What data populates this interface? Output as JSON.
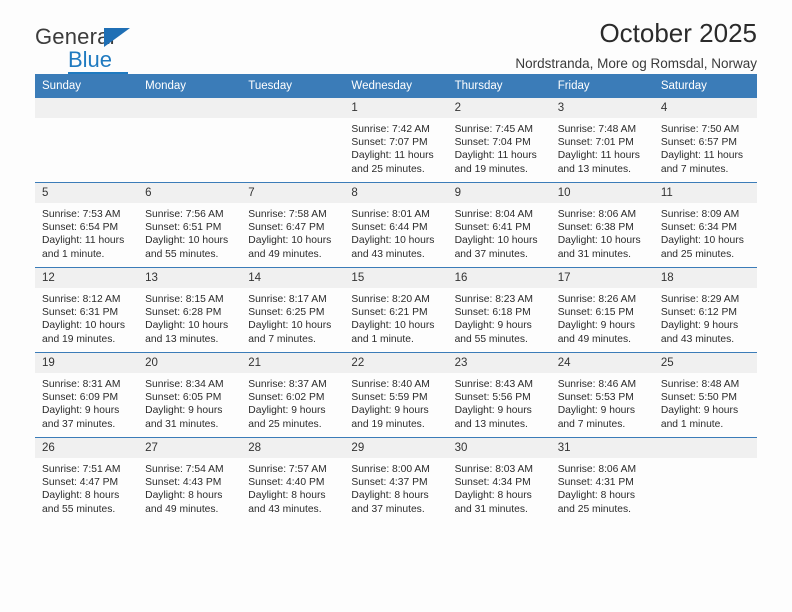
{
  "brand": {
    "name_part1": "General",
    "name_part2": "Blue",
    "triangle_icon": "triangle-icon",
    "accent_color": "#1f7ac0"
  },
  "header": {
    "title": "October 2025",
    "subtitle": "Nordstranda, More og Romsdal, Norway",
    "header_bg_color": "#3b7cb8",
    "daynum_bg_color": "#f0f0f0"
  },
  "weekday_headers": [
    "Sunday",
    "Monday",
    "Tuesday",
    "Wednesday",
    "Thursday",
    "Friday",
    "Saturday"
  ],
  "labels": {
    "sunrise": "Sunrise:",
    "sunset": "Sunset:",
    "daylight": "Daylight:"
  },
  "weeks": [
    [
      {
        "day": "",
        "empty": true
      },
      {
        "day": "",
        "empty": true
      },
      {
        "day": "",
        "empty": true
      },
      {
        "day": "1",
        "sunrise": "Sunrise: 7:42 AM",
        "sunset": "Sunset: 7:07 PM",
        "daylight_line1": "Daylight: 11 hours",
        "daylight_line2": "and 25 minutes."
      },
      {
        "day": "2",
        "sunrise": "Sunrise: 7:45 AM",
        "sunset": "Sunset: 7:04 PM",
        "daylight_line1": "Daylight: 11 hours",
        "daylight_line2": "and 19 minutes."
      },
      {
        "day": "3",
        "sunrise": "Sunrise: 7:48 AM",
        "sunset": "Sunset: 7:01 PM",
        "daylight_line1": "Daylight: 11 hours",
        "daylight_line2": "and 13 minutes."
      },
      {
        "day": "4",
        "sunrise": "Sunrise: 7:50 AM",
        "sunset": "Sunset: 6:57 PM",
        "daylight_line1": "Daylight: 11 hours",
        "daylight_line2": "and 7 minutes."
      }
    ],
    [
      {
        "day": "5",
        "sunrise": "Sunrise: 7:53 AM",
        "sunset": "Sunset: 6:54 PM",
        "daylight_line1": "Daylight: 11 hours",
        "daylight_line2": "and 1 minute."
      },
      {
        "day": "6",
        "sunrise": "Sunrise: 7:56 AM",
        "sunset": "Sunset: 6:51 PM",
        "daylight_line1": "Daylight: 10 hours",
        "daylight_line2": "and 55 minutes."
      },
      {
        "day": "7",
        "sunrise": "Sunrise: 7:58 AM",
        "sunset": "Sunset: 6:47 PM",
        "daylight_line1": "Daylight: 10 hours",
        "daylight_line2": "and 49 minutes."
      },
      {
        "day": "8",
        "sunrise": "Sunrise: 8:01 AM",
        "sunset": "Sunset: 6:44 PM",
        "daylight_line1": "Daylight: 10 hours",
        "daylight_line2": "and 43 minutes."
      },
      {
        "day": "9",
        "sunrise": "Sunrise: 8:04 AM",
        "sunset": "Sunset: 6:41 PM",
        "daylight_line1": "Daylight: 10 hours",
        "daylight_line2": "and 37 minutes."
      },
      {
        "day": "10",
        "sunrise": "Sunrise: 8:06 AM",
        "sunset": "Sunset: 6:38 PM",
        "daylight_line1": "Daylight: 10 hours",
        "daylight_line2": "and 31 minutes."
      },
      {
        "day": "11",
        "sunrise": "Sunrise: 8:09 AM",
        "sunset": "Sunset: 6:34 PM",
        "daylight_line1": "Daylight: 10 hours",
        "daylight_line2": "and 25 minutes."
      }
    ],
    [
      {
        "day": "12",
        "sunrise": "Sunrise: 8:12 AM",
        "sunset": "Sunset: 6:31 PM",
        "daylight_line1": "Daylight: 10 hours",
        "daylight_line2": "and 19 minutes."
      },
      {
        "day": "13",
        "sunrise": "Sunrise: 8:15 AM",
        "sunset": "Sunset: 6:28 PM",
        "daylight_line1": "Daylight: 10 hours",
        "daylight_line2": "and 13 minutes."
      },
      {
        "day": "14",
        "sunrise": "Sunrise: 8:17 AM",
        "sunset": "Sunset: 6:25 PM",
        "daylight_line1": "Daylight: 10 hours",
        "daylight_line2": "and 7 minutes."
      },
      {
        "day": "15",
        "sunrise": "Sunrise: 8:20 AM",
        "sunset": "Sunset: 6:21 PM",
        "daylight_line1": "Daylight: 10 hours",
        "daylight_line2": "and 1 minute."
      },
      {
        "day": "16",
        "sunrise": "Sunrise: 8:23 AM",
        "sunset": "Sunset: 6:18 PM",
        "daylight_line1": "Daylight: 9 hours",
        "daylight_line2": "and 55 minutes."
      },
      {
        "day": "17",
        "sunrise": "Sunrise: 8:26 AM",
        "sunset": "Sunset: 6:15 PM",
        "daylight_line1": "Daylight: 9 hours",
        "daylight_line2": "and 49 minutes."
      },
      {
        "day": "18",
        "sunrise": "Sunrise: 8:29 AM",
        "sunset": "Sunset: 6:12 PM",
        "daylight_line1": "Daylight: 9 hours",
        "daylight_line2": "and 43 minutes."
      }
    ],
    [
      {
        "day": "19",
        "sunrise": "Sunrise: 8:31 AM",
        "sunset": "Sunset: 6:09 PM",
        "daylight_line1": "Daylight: 9 hours",
        "daylight_line2": "and 37 minutes."
      },
      {
        "day": "20",
        "sunrise": "Sunrise: 8:34 AM",
        "sunset": "Sunset: 6:05 PM",
        "daylight_line1": "Daylight: 9 hours",
        "daylight_line2": "and 31 minutes."
      },
      {
        "day": "21",
        "sunrise": "Sunrise: 8:37 AM",
        "sunset": "Sunset: 6:02 PM",
        "daylight_line1": "Daylight: 9 hours",
        "daylight_line2": "and 25 minutes."
      },
      {
        "day": "22",
        "sunrise": "Sunrise: 8:40 AM",
        "sunset": "Sunset: 5:59 PM",
        "daylight_line1": "Daylight: 9 hours",
        "daylight_line2": "and 19 minutes."
      },
      {
        "day": "23",
        "sunrise": "Sunrise: 8:43 AM",
        "sunset": "Sunset: 5:56 PM",
        "daylight_line1": "Daylight: 9 hours",
        "daylight_line2": "and 13 minutes."
      },
      {
        "day": "24",
        "sunrise": "Sunrise: 8:46 AM",
        "sunset": "Sunset: 5:53 PM",
        "daylight_line1": "Daylight: 9 hours",
        "daylight_line2": "and 7 minutes."
      },
      {
        "day": "25",
        "sunrise": "Sunrise: 8:48 AM",
        "sunset": "Sunset: 5:50 PM",
        "daylight_line1": "Daylight: 9 hours",
        "daylight_line2": "and 1 minute."
      }
    ],
    [
      {
        "day": "26",
        "sunrise": "Sunrise: 7:51 AM",
        "sunset": "Sunset: 4:47 PM",
        "daylight_line1": "Daylight: 8 hours",
        "daylight_line2": "and 55 minutes."
      },
      {
        "day": "27",
        "sunrise": "Sunrise: 7:54 AM",
        "sunset": "Sunset: 4:43 PM",
        "daylight_line1": "Daylight: 8 hours",
        "daylight_line2": "and 49 minutes."
      },
      {
        "day": "28",
        "sunrise": "Sunrise: 7:57 AM",
        "sunset": "Sunset: 4:40 PM",
        "daylight_line1": "Daylight: 8 hours",
        "daylight_line2": "and 43 minutes."
      },
      {
        "day": "29",
        "sunrise": "Sunrise: 8:00 AM",
        "sunset": "Sunset: 4:37 PM",
        "daylight_line1": "Daylight: 8 hours",
        "daylight_line2": "and 37 minutes."
      },
      {
        "day": "30",
        "sunrise": "Sunrise: 8:03 AM",
        "sunset": "Sunset: 4:34 PM",
        "daylight_line1": "Daylight: 8 hours",
        "daylight_line2": "and 31 minutes."
      },
      {
        "day": "31",
        "sunrise": "Sunrise: 8:06 AM",
        "sunset": "Sunset: 4:31 PM",
        "daylight_line1": "Daylight: 8 hours",
        "daylight_line2": "and 25 minutes."
      },
      {
        "day": "",
        "empty": true
      }
    ]
  ]
}
